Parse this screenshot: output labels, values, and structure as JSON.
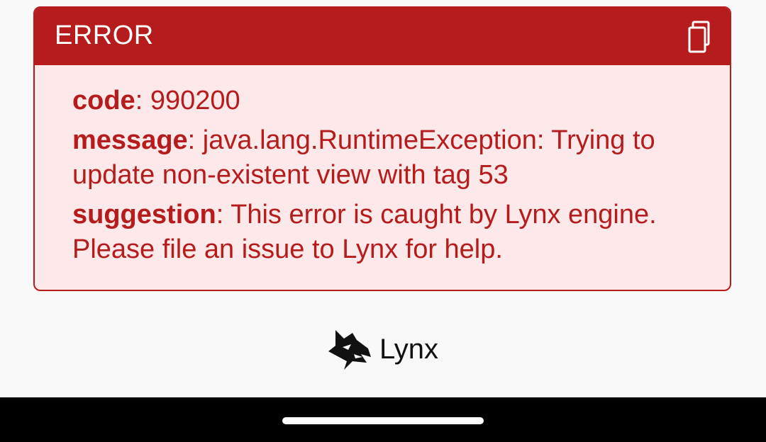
{
  "error": {
    "title": "ERROR",
    "copy_icon": "copy-icon",
    "fields": [
      {
        "key": "code",
        "separator": ": ",
        "value": "990200"
      },
      {
        "key": "message",
        "separator": ": ",
        "value": "java.lang.RuntimeException: Trying to update non-existent view with tag 53"
      },
      {
        "key": "suggestion",
        "separator": ": ",
        "value": "This error is caught by Lynx engine. Please file an issue to Lynx for help."
      }
    ]
  },
  "brand": {
    "name": "Lynx",
    "logo_icon": "lynx-logo-icon"
  },
  "colors": {
    "error_red": "#b71c1c",
    "card_background": "#fde8ea",
    "page_background": "#f9f9f9",
    "nav_bar": "#000000"
  }
}
